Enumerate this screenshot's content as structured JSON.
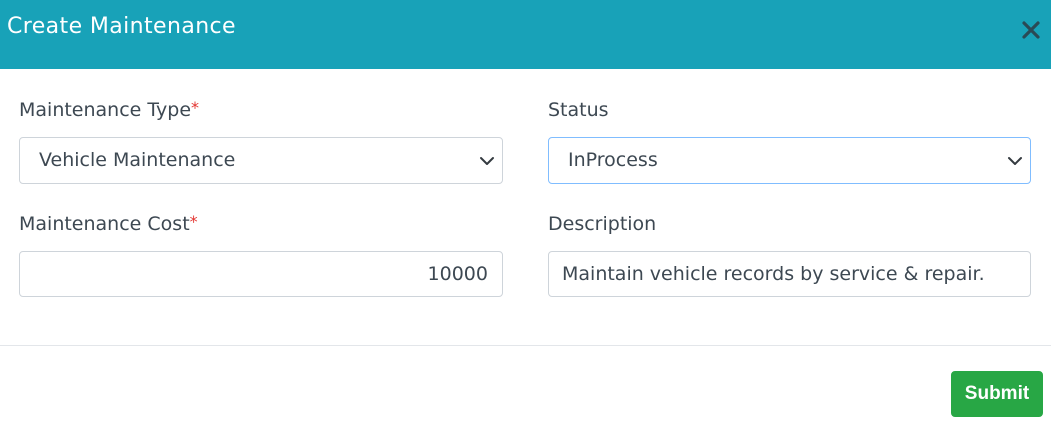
{
  "modal": {
    "title": "Create Maintenance",
    "close_icon": "close-icon"
  },
  "form": {
    "maintenance_type": {
      "label": "Maintenance Type",
      "required_mark": "*",
      "selected": "Vehicle Maintenance"
    },
    "status": {
      "label": "Status",
      "selected": "InProcess"
    },
    "maintenance_cost": {
      "label": "Maintenance Cost",
      "required_mark": "*",
      "value": "10000"
    },
    "description": {
      "label": "Description",
      "value": "Maintain vehicle records by service & repair."
    }
  },
  "footer": {
    "submit_label": "Submit"
  },
  "colors": {
    "header_bg": "#18a2b8",
    "submit_bg": "#28a745",
    "required": "#e3342f"
  }
}
